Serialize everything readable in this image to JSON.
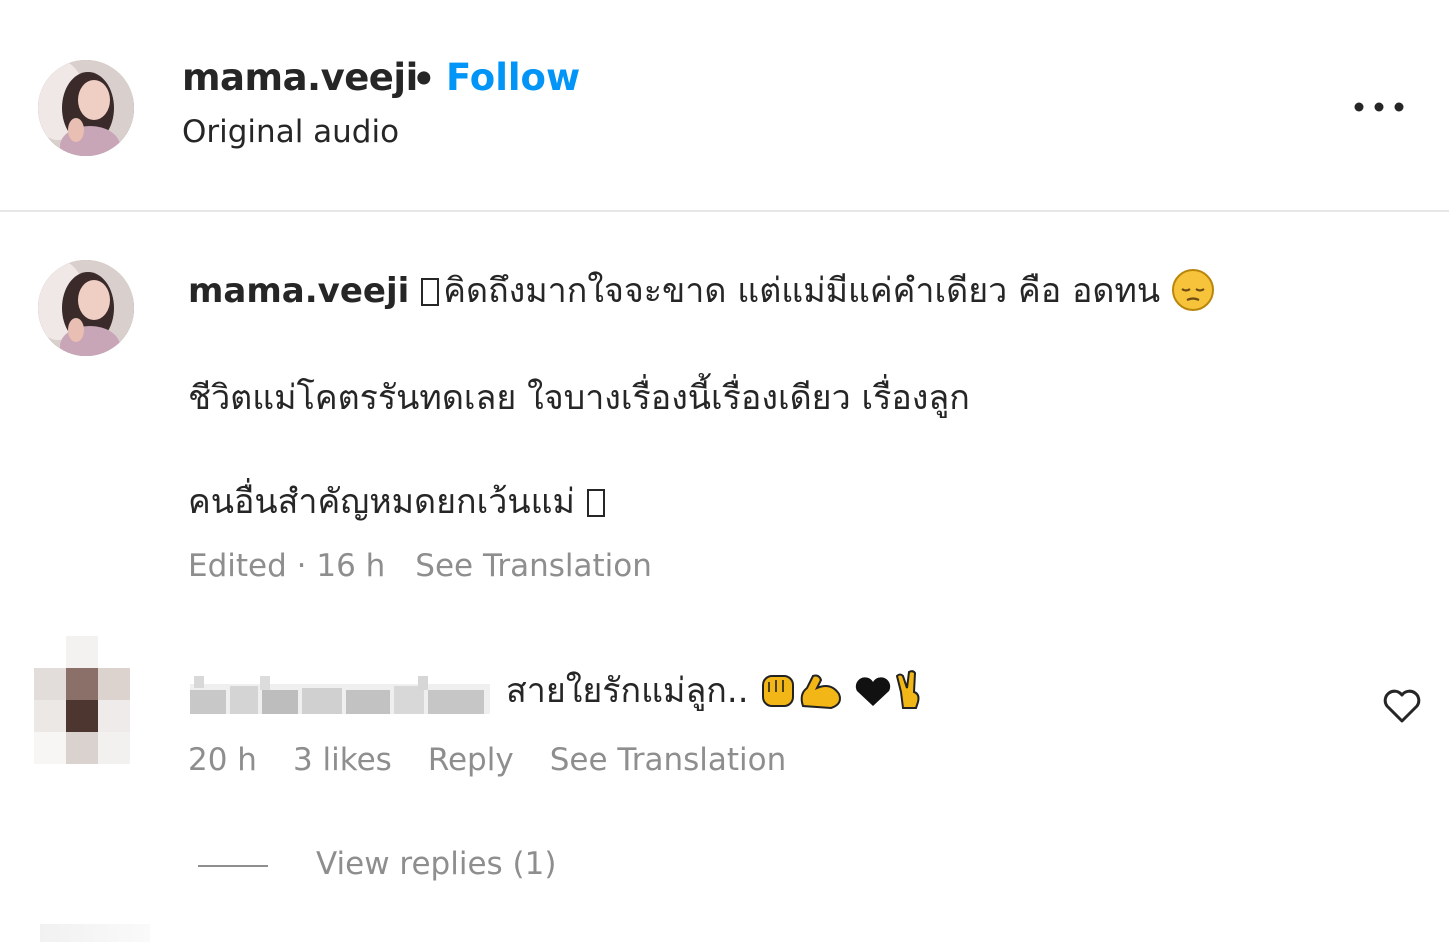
{
  "post": {
    "username": "mama.veeji",
    "separator": "•",
    "follow_label": "Follow",
    "audio_label": "Original audio",
    "more_icon": "more-horizontal-icon"
  },
  "caption": {
    "username": "mama.veeji",
    "line1_text": "คิดถึงมากใจจะขาด แต่แม่มีแค่คำเดียว คือ อดทน",
    "line1_emoji": "pensive-face-icon",
    "line2_text": "ชีวิตแม่โคตรรันทดเลย ใจบางเรื่องนี้เรื่องเดียว เรื่องลูก",
    "line3_text": "คนอื่นสำคัญหมดยกเว้นแม่",
    "meta": "Edited · 16 h",
    "see_translation": "See Translation"
  },
  "comment": {
    "text": "สายใยรักแม่ลูก..",
    "emojis": [
      "raised-fist-icon",
      "flexed-biceps-icon",
      "black-heart-icon",
      "victory-hand-icon"
    ],
    "time": "20 h",
    "likes": "3 likes",
    "reply_label": "Reply",
    "see_translation": "See Translation",
    "view_replies": "View replies (1)",
    "like_icon": "heart-outline-icon"
  },
  "colors": {
    "text": "#262626",
    "secondary": "#8e8e8e",
    "link": "#0095f6",
    "divider": "#e7e7e7"
  }
}
